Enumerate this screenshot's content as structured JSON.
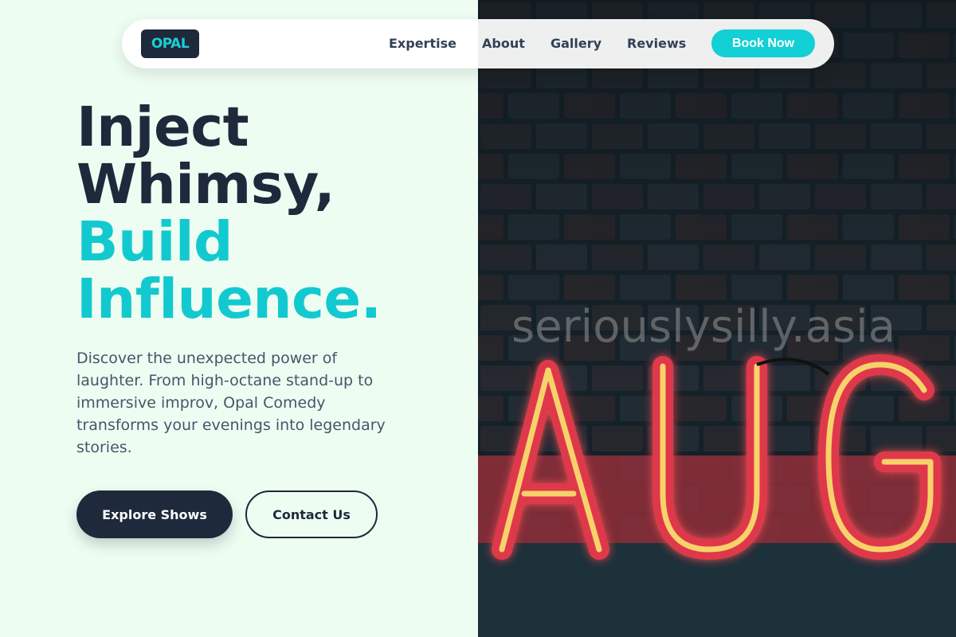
{
  "nav": {
    "logo": "OPAL",
    "links": [
      "Expertise",
      "About",
      "Gallery",
      "Reviews"
    ],
    "cta": "Book Now"
  },
  "hero": {
    "headline_line1": "Inject",
    "headline_line2": "Whimsy,",
    "headline_line3": "Build",
    "headline_line4": "Influence.",
    "description": "Discover the unexpected power of laughter. From high-octane stand-up to immersive improv, Opal Comedy transforms your evenings into legendary stories.",
    "primary_button": "Explore Shows",
    "secondary_button": "Contact Us"
  },
  "image": {
    "watermark": "seriouslysilly.asia",
    "sign_text": "AUG"
  },
  "colors": {
    "brand_dark": "#1e293b",
    "accent": "#12d0d5",
    "background": "#eefdf2"
  }
}
